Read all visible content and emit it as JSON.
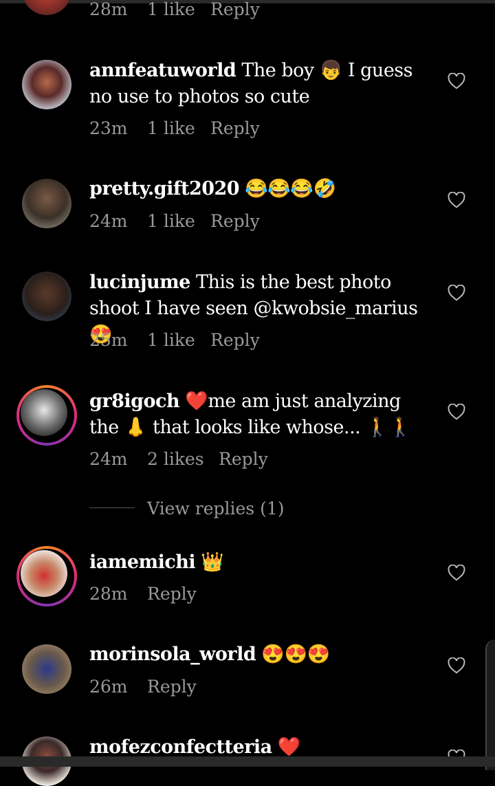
{
  "comments_top": {
    "time": "28m",
    "likes": "1 like",
    "reply": "Reply"
  },
  "comments": [
    {
      "username": "annfeatuworld",
      "text": "The boy 👦 I guess no use to photos so cute",
      "time": "23m",
      "likes": "1 like",
      "reply": "Reply"
    },
    {
      "username": "pretty.gift2020",
      "text": "😂😂😂🤣",
      "time": "24m",
      "likes": "1 like",
      "reply": "Reply"
    },
    {
      "username": "lucinjume",
      "text": "This is the best photo shoot I have seen @kwobsie_marius 😍",
      "time": "25m",
      "likes": "1 like",
      "reply": "Reply"
    },
    {
      "username": "gr8igoch",
      "text": "❤️me am just analyzing the 👃 that looks like whose... 🚶🚶",
      "time": "24m",
      "likes": "2 likes",
      "reply": "Reply",
      "view_replies": "View replies (1)"
    },
    {
      "username": "iamemichi",
      "text": "👑",
      "time": "28m",
      "reply": "Reply"
    },
    {
      "username": "morinsola_world",
      "text": "😍😍😍",
      "time": "26m",
      "reply": "Reply"
    },
    {
      "username": "mofezconfectteria",
      "text": "❤️"
    }
  ],
  "icons": {
    "like": "heart-outline-icon"
  },
  "colors": {
    "background": "#000000",
    "text": "#ffffff",
    "meta": "#9a9a9a",
    "story_ring": "#dd2a7b"
  }
}
